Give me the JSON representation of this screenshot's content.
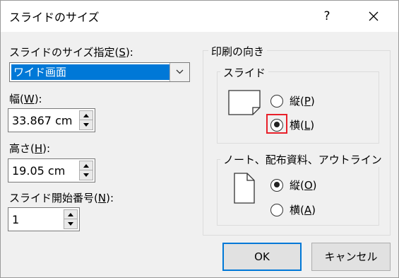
{
  "dialog": {
    "title": "スライドのサイズ",
    "help": "?"
  },
  "left": {
    "slide_size_label": "スライドのサイズ指定(",
    "slide_size_key": "S",
    "slide_size_tail": "):",
    "slide_size_value": "ワイド画面",
    "width_label": "幅(",
    "width_key": "W",
    "width_tail": "):",
    "width_value": "33.867 cm",
    "height_label": "高さ(",
    "height_key": "H",
    "height_tail": "):",
    "height_value": "19.05 cm",
    "start_label": "スライド開始番号(",
    "start_key": "N",
    "start_tail": "):",
    "start_value": "1"
  },
  "orientation": {
    "title": "印刷の向き",
    "slides": {
      "title": "スライド",
      "portrait_label": "縦(",
      "portrait_key": "P",
      "portrait_tail": ")",
      "landscape_label": "横(",
      "landscape_key": "L",
      "landscape_tail": ")",
      "selected": "landscape"
    },
    "notes": {
      "title": "ノート、配布資料、アウトライン",
      "portrait_label": "縦(",
      "portrait_key": "O",
      "portrait_tail": ")",
      "landscape_label": "横(",
      "landscape_key": "A",
      "landscape_tail": ")",
      "selected": "portrait"
    }
  },
  "buttons": {
    "ok": "OK",
    "cancel": "キャンセル"
  },
  "colors": {
    "accent": "#0078d7",
    "focus_highlight": "#e8202a"
  }
}
